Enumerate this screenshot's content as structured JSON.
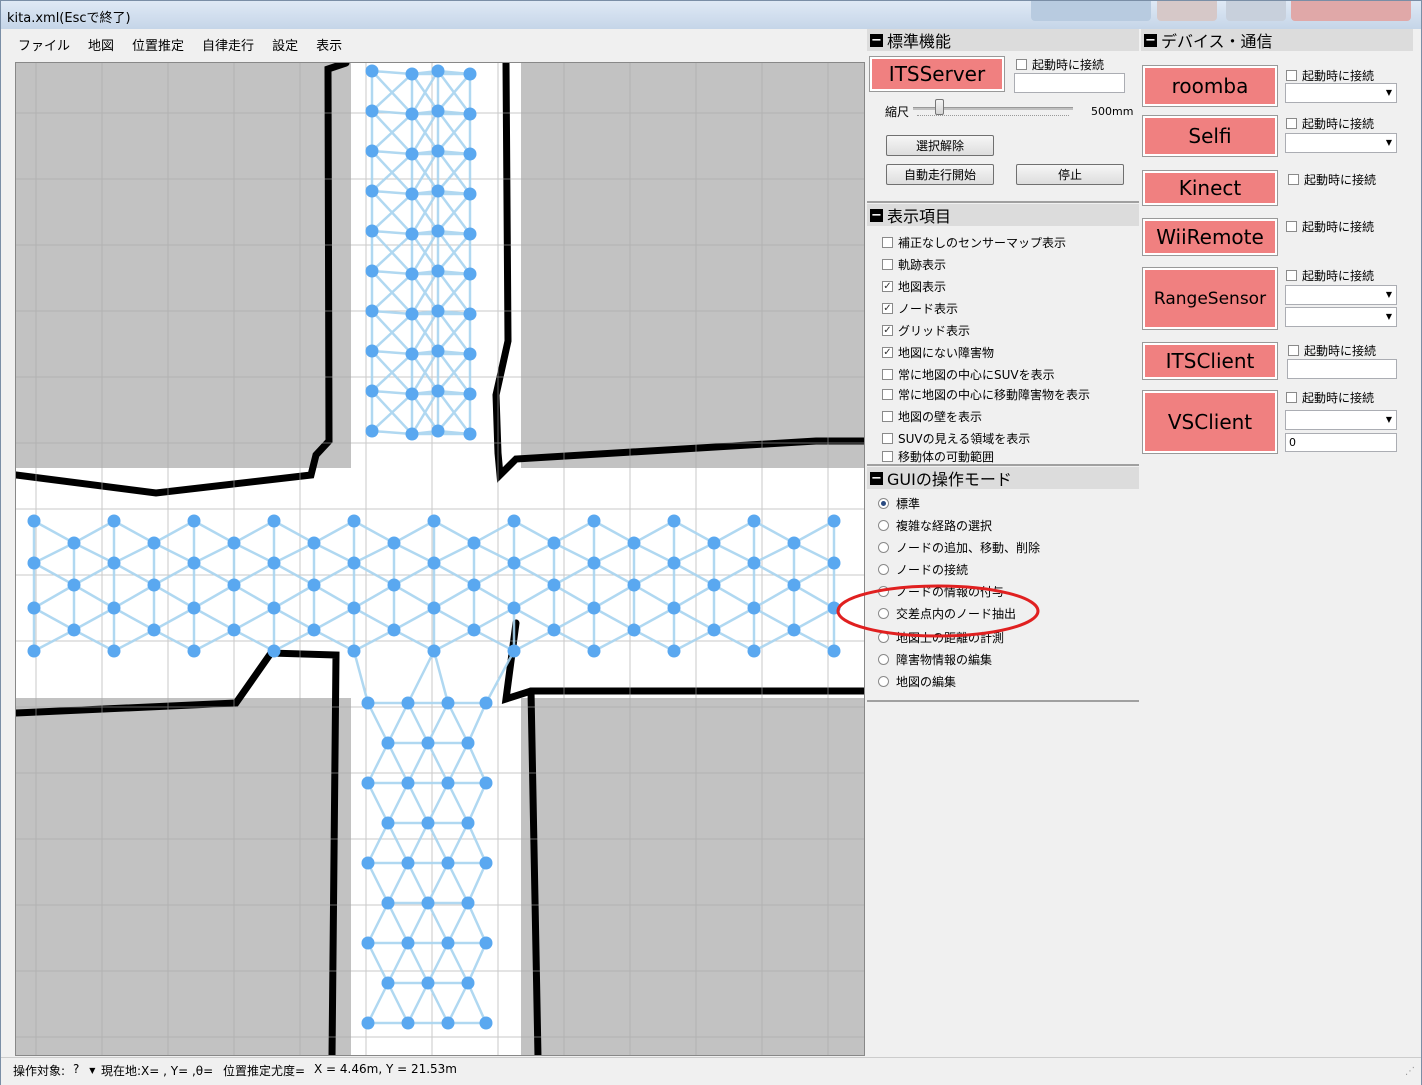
{
  "window": {
    "title": "kita.xml(Escで終了)"
  },
  "menu": [
    "ファイル",
    "地図",
    "位置推定",
    "自律走行",
    "設定",
    "表示"
  ],
  "standard": {
    "header": "標準機能",
    "server_button": "ITSServer",
    "connect_label": "起動時に接続",
    "scale_label": "縮尺",
    "scale_value": "500mm",
    "deselect_button": "選択解除",
    "auto_start_button": "自動走行開始",
    "stop_button": "停止"
  },
  "display": {
    "header": "表示項目",
    "items": [
      {
        "label": "補正なしのセンサーマップ表示",
        "checked": false
      },
      {
        "label": "軌跡表示",
        "checked": false
      },
      {
        "label": "地図表示",
        "checked": true
      },
      {
        "label": "ノード表示",
        "checked": true
      },
      {
        "label": "グリッド表示",
        "checked": true
      },
      {
        "label": "地図にない障害物",
        "checked": true
      },
      {
        "label": "常に地図の中心にSUVを表示",
        "checked": false
      },
      {
        "label": "常に地図の中心に移動障害物を表示",
        "checked": false
      },
      {
        "label": "地図の壁を表示",
        "checked": false
      },
      {
        "label": "SUVの見える領域を表示",
        "checked": false
      },
      {
        "label": "移動体の可動範囲",
        "checked": false
      }
    ]
  },
  "gui_mode": {
    "header": "GUIの操作モード",
    "options": [
      {
        "label": "標準",
        "selected": true
      },
      {
        "label": "複雑な経路の選択",
        "selected": false
      },
      {
        "label": "ノードの追加、移動、削除",
        "selected": false
      },
      {
        "label": "ノードの接続",
        "selected": false
      },
      {
        "label": "ノードの情報の付与",
        "selected": false
      },
      {
        "label": "交差点内のノード抽出",
        "selected": false
      },
      {
        "label": "地図上の距離の計測",
        "selected": false
      },
      {
        "label": "障害物情報の編集",
        "selected": false
      },
      {
        "label": "地図の編集",
        "selected": false
      }
    ]
  },
  "devices": {
    "header": "デバイス・通信",
    "connect_label": "起動時に接続",
    "items": [
      {
        "label": "roomba"
      },
      {
        "label": "Selfi"
      },
      {
        "label": "Kinect"
      },
      {
        "label": "WiiRemote"
      },
      {
        "label": "RangeSensor"
      },
      {
        "label": "ITSClient"
      },
      {
        "label": "VSClient",
        "field_value": "0"
      }
    ]
  },
  "status": {
    "target_label": "操作対象:",
    "target_value": "?",
    "position": "現在地:X= , Y= ,θ=",
    "likelihood": "位置推定尤度=",
    "coords": "X = 4.46m, Y = 21.53m"
  },
  "colors": {
    "device_button": "#f08080",
    "node": "#5aa8f0",
    "edge": "#a8d4f0",
    "highlight": "#e02020"
  }
}
